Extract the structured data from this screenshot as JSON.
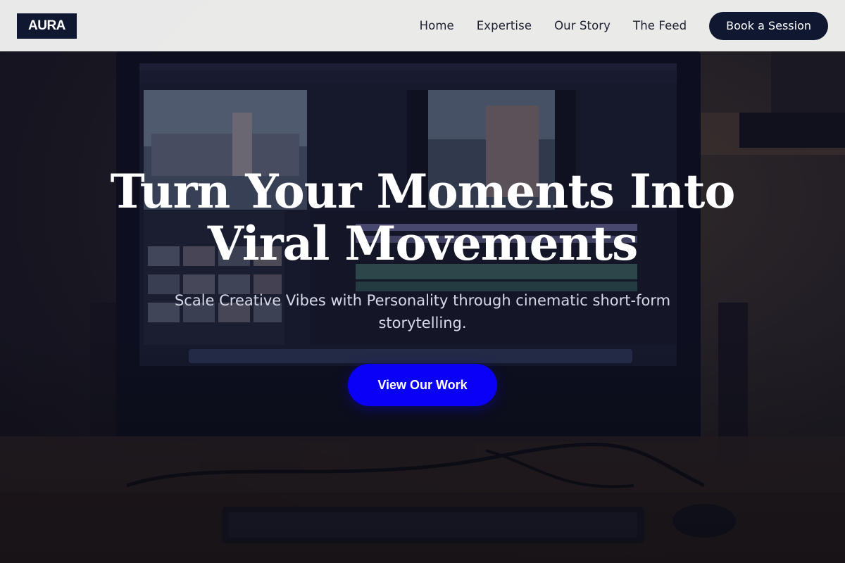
{
  "brand": {
    "logo_text": "AURA"
  },
  "nav": {
    "items": [
      {
        "label": "Home"
      },
      {
        "label": "Expertise"
      },
      {
        "label": "Our Story"
      },
      {
        "label": "The Feed"
      }
    ],
    "cta_label": "Book a Session"
  },
  "hero": {
    "title_line1": "Turn Your Moments Into",
    "title_line2": "Viral Movements",
    "subtitle": "Scale Creative Vibes with Personality through cinematic short-form storytelling.",
    "cta_label": "View Our Work",
    "background_image": "desk-monitor-video-editing-photo"
  },
  "colors": {
    "header_bg": "#f3f2f1",
    "brand_dark": "#101730",
    "accent_blue": "#0a00f5",
    "title_text": "#ffffff",
    "subtitle_text": "#d7dbe8"
  }
}
